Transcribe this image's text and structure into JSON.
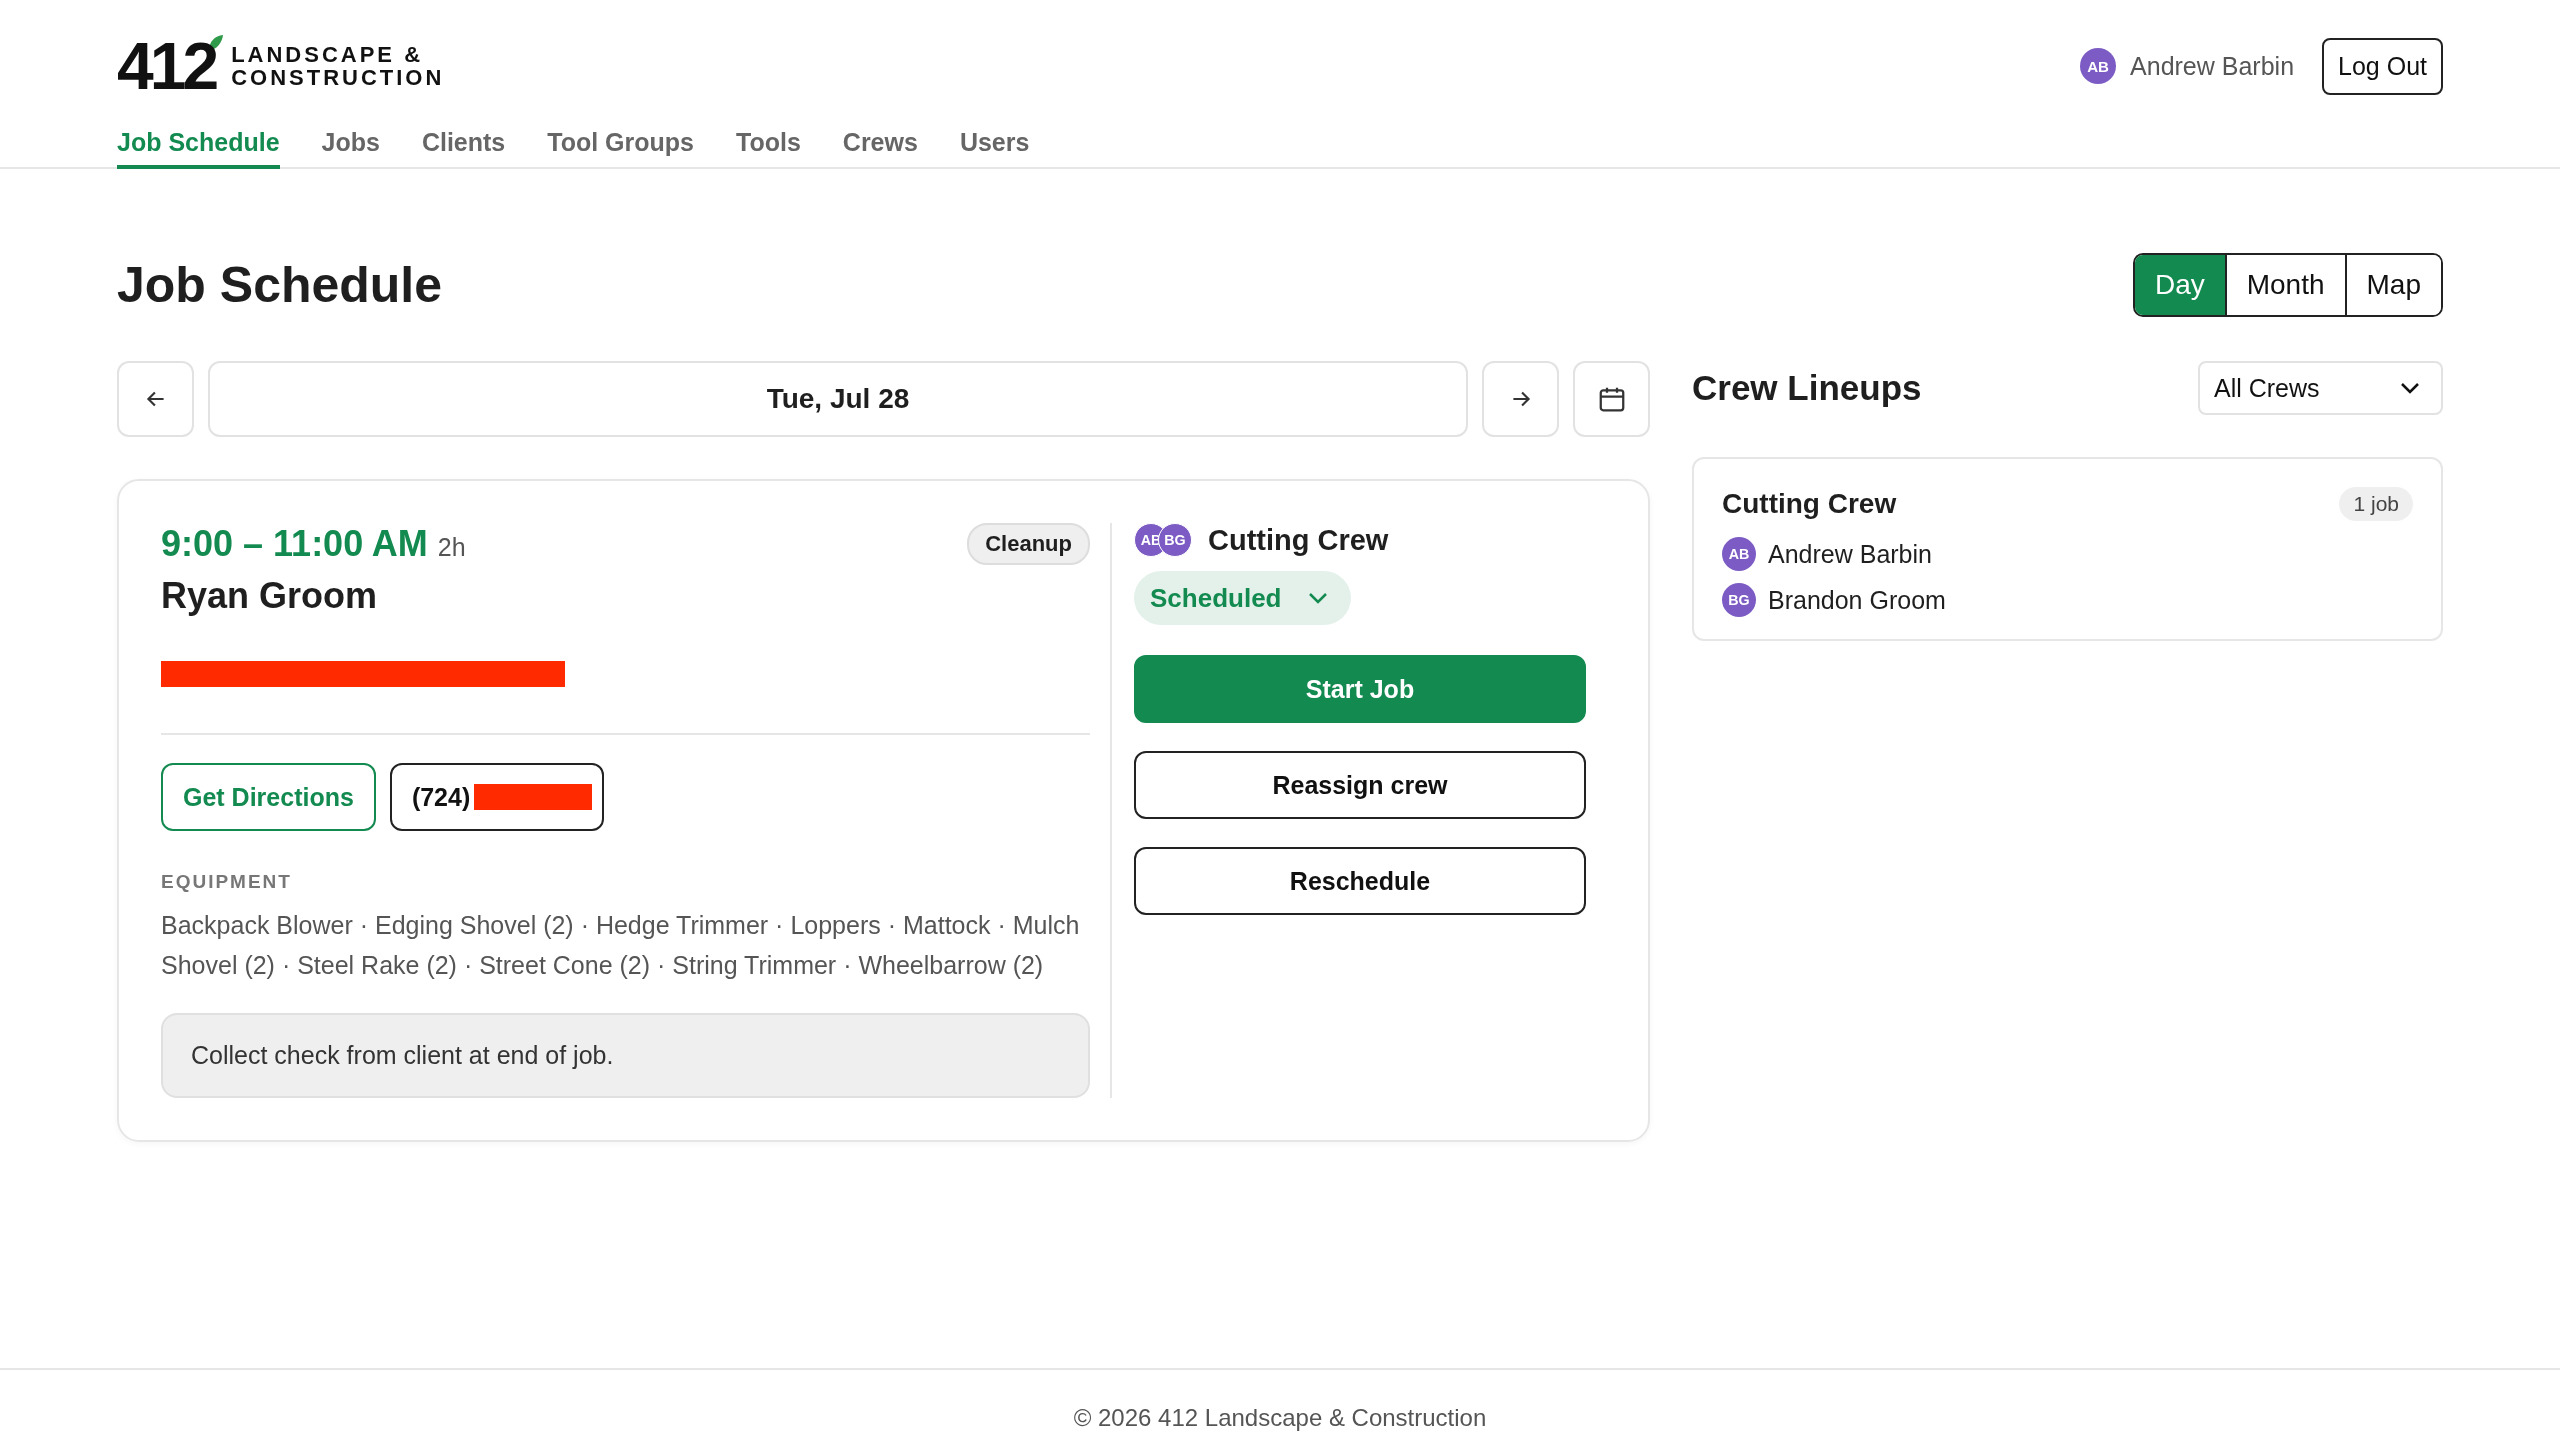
{
  "brand": {
    "number": "412",
    "line_1": "LANDSCAPE &",
    "line_2": "CONSTRUCTION"
  },
  "user": {
    "initials": "AB",
    "name": "Andrew Barbin",
    "color": "#7c5cc4"
  },
  "logout": "Log Out",
  "nav": [
    {
      "label": "Job Schedule",
      "selected": true
    },
    {
      "label": "Jobs",
      "selected": false
    },
    {
      "label": "Clients",
      "selected": false
    },
    {
      "label": "Tool Groups",
      "selected": false
    },
    {
      "label": "Tools",
      "selected": false
    },
    {
      "label": "Crews",
      "selected": false
    },
    {
      "label": "Users",
      "selected": false
    }
  ],
  "page_title": "Job Schedule",
  "views": [
    {
      "label": "Day",
      "selected": true
    },
    {
      "label": "Month",
      "selected": false
    },
    {
      "label": "Map",
      "selected": false
    }
  ],
  "date": "Tue, Jul 28",
  "job": {
    "time": "9:00 – 11:00 AM",
    "duration": "2h",
    "client": "Ryan Groom",
    "tag": "Cleanup",
    "address_redacted": true,
    "directions": "Get Directions",
    "phone_prefix": "(724)",
    "phone_redacted": true,
    "equipment_label": "EQUIPMENT",
    "equipment": "Backpack Blower · Edging Shovel (2) · Hedge Trimmer · Loppers · Mattock · Mulch Shovel (2) · Steel Rake (2) · Street Cone (2) · String Trimmer · Wheelbarrow (2)",
    "note": "Collect check from client at end of job.",
    "crew_initials": [
      {
        "initials": "AB",
        "color": "#7c5cc4"
      },
      {
        "initials": "BG",
        "color": "#7c5cc4"
      }
    ],
    "crew": "Cutting Crew",
    "status": "Scheduled",
    "actions": [
      {
        "label": "Start Job",
        "kind": "primary"
      },
      {
        "label": "Reassign crew",
        "kind": "outline"
      },
      {
        "label": "Reschedule",
        "kind": "outline"
      }
    ]
  },
  "lineups": {
    "title": "Crew Lineups",
    "filter": "All Crews",
    "crews": [
      {
        "name": "Cutting Crew",
        "count": "1 job",
        "members": [
          {
            "initials": "AB",
            "name": "Andrew Barbin",
            "color": "#7c5cc4"
          },
          {
            "initials": "BG",
            "name": "Brandon Groom",
            "color": "#7c5cc4"
          }
        ]
      }
    ]
  },
  "footer": "© 2026 412 Landscape & Construction"
}
